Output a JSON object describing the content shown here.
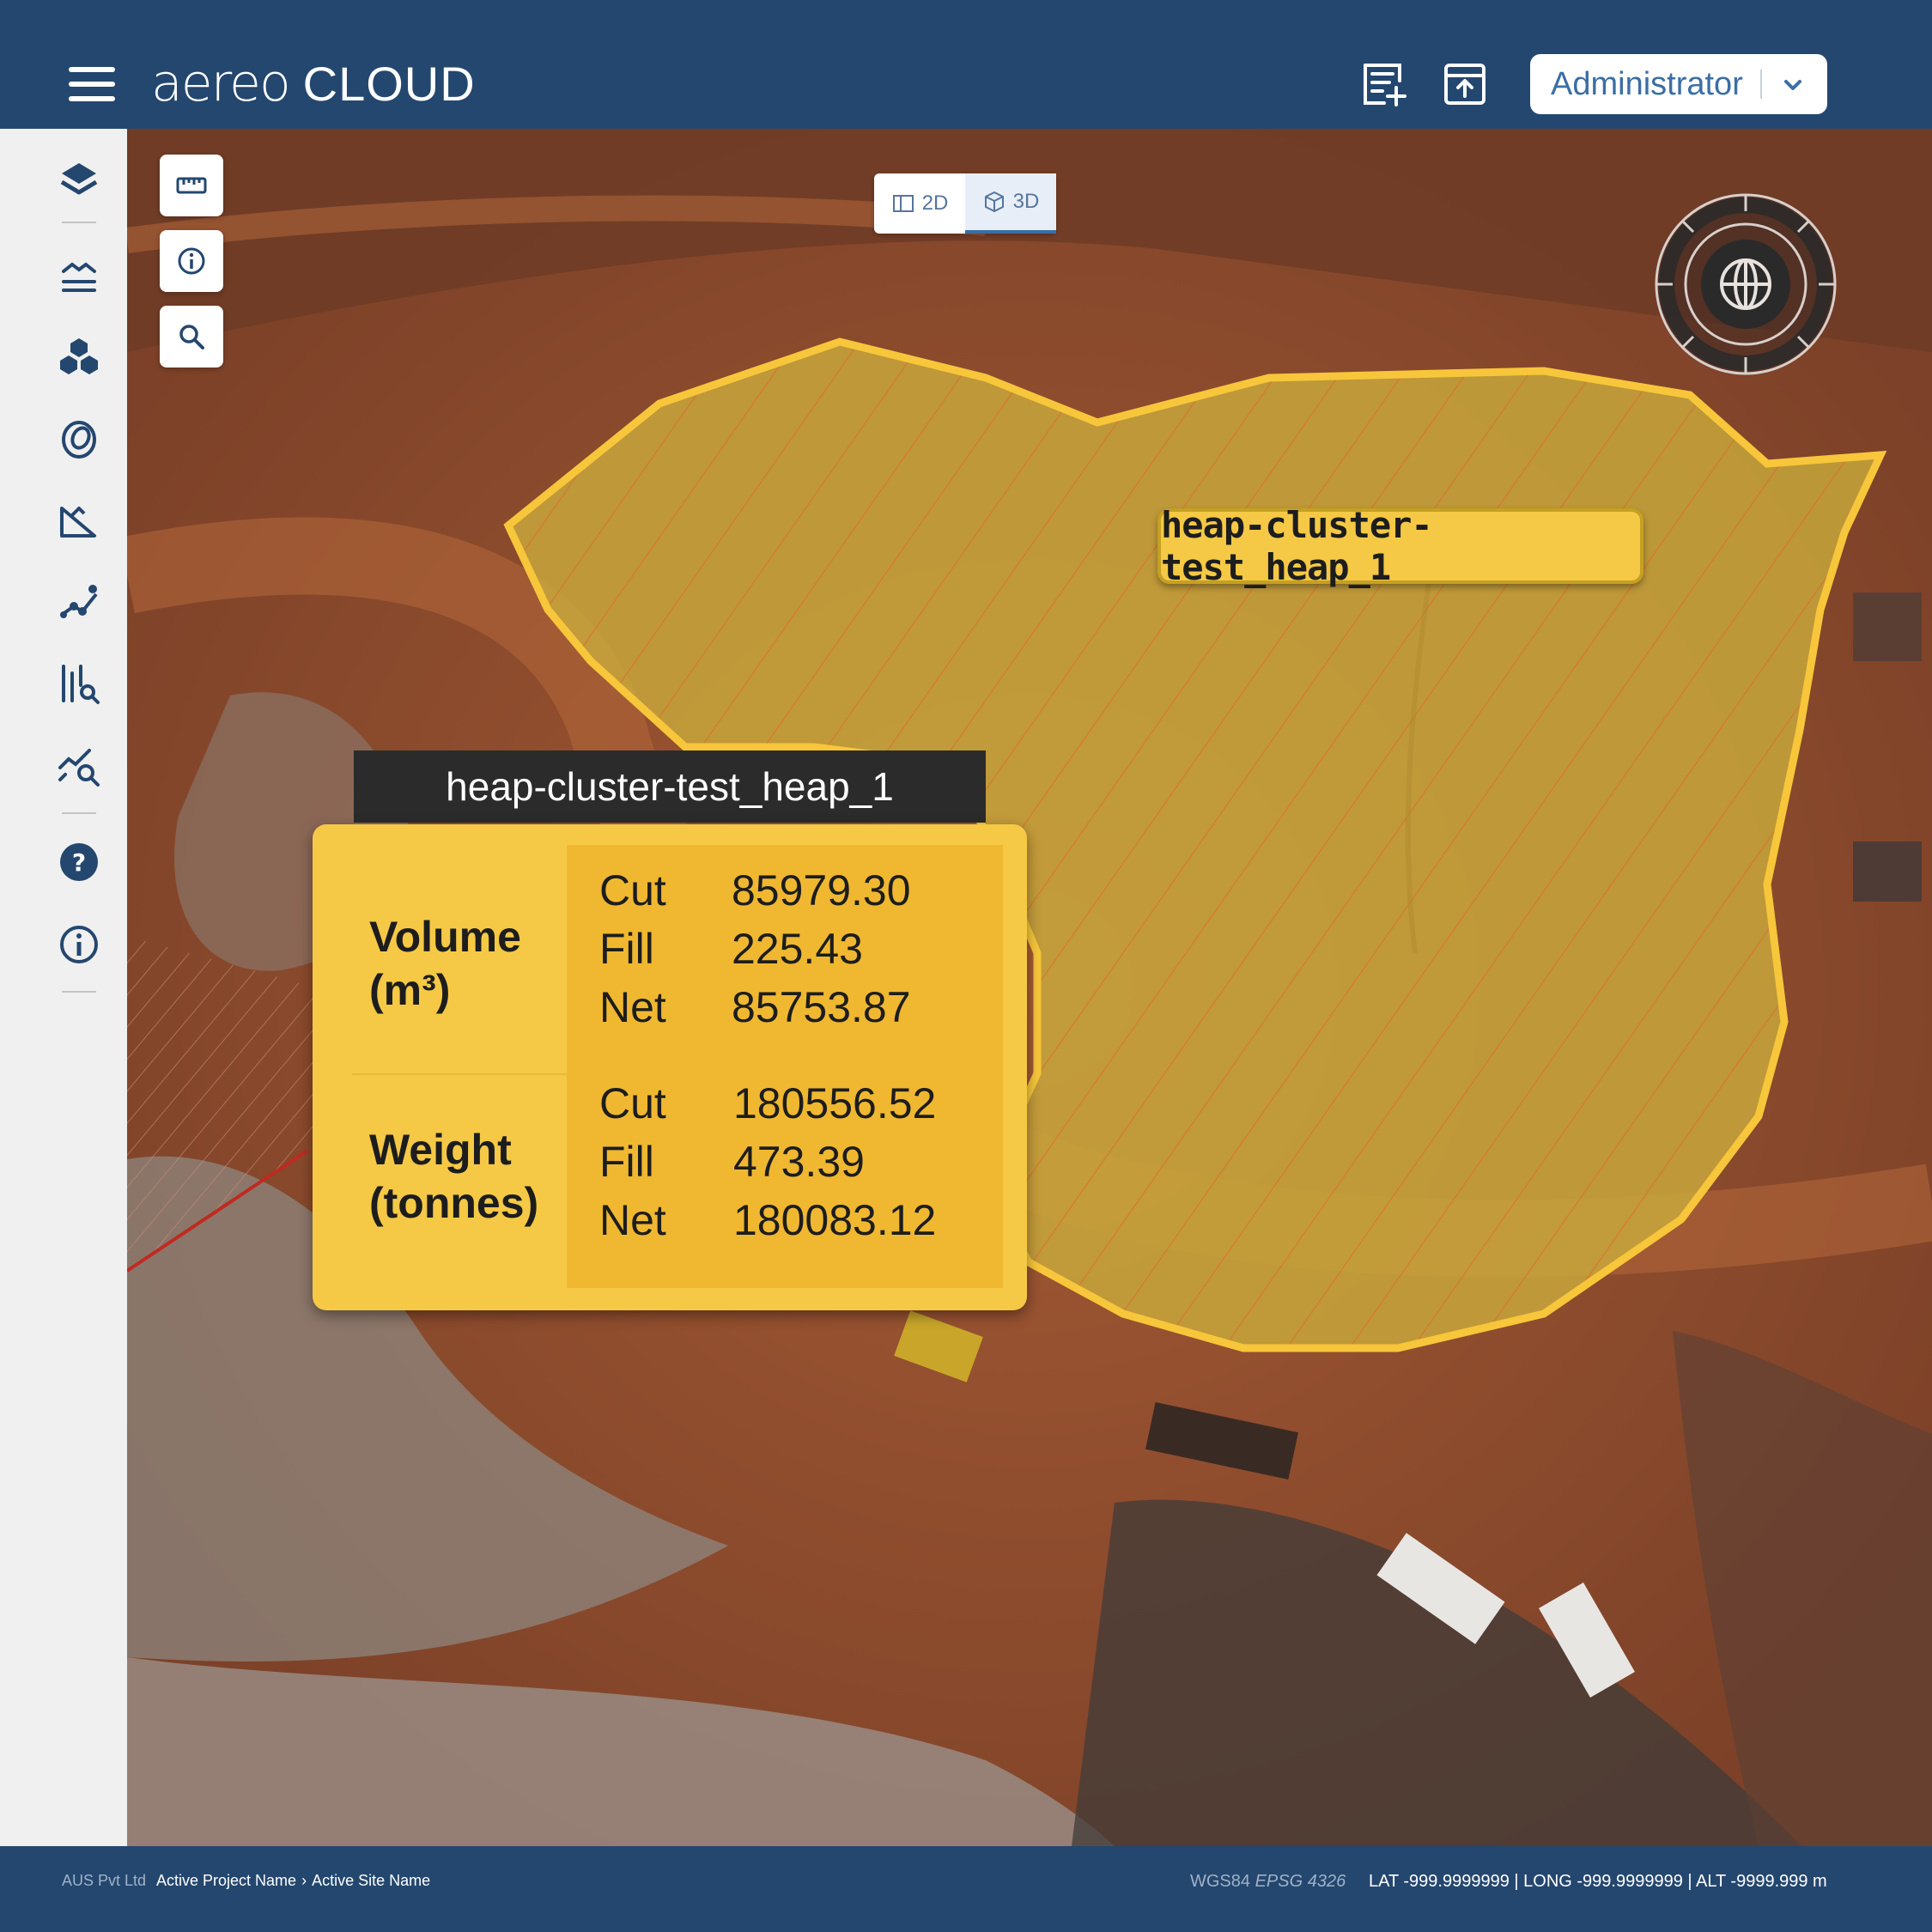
{
  "app": {
    "brand_mark": "aereo",
    "brand_suffix": "CLOUD"
  },
  "header": {
    "user_role": "Administrator"
  },
  "sidebar": {
    "items": [
      {
        "name": "layers"
      },
      {
        "name": "elevation"
      },
      {
        "name": "stockpiles"
      },
      {
        "name": "contours"
      },
      {
        "name": "slope"
      },
      {
        "name": "alignment"
      },
      {
        "name": "cross-section"
      },
      {
        "name": "analytics-search"
      },
      {
        "name": "help"
      },
      {
        "name": "info"
      }
    ]
  },
  "map": {
    "view_modes": [
      {
        "label": "2D",
        "active": false
      },
      {
        "label": "3D",
        "active": true
      }
    ],
    "heap_label": "heap-cluster-test_heap_1",
    "accent_color": "#f5c945"
  },
  "popup": {
    "title": "heap-cluster-test_heap_1",
    "volume": {
      "heading_line1": "Volume",
      "heading_line2": "(m³)",
      "cut_label": "Cut",
      "cut_value": "85979.30",
      "fill_label": "Fill",
      "fill_value": "225.43",
      "net_label": "Net",
      "net_value": "85753.87"
    },
    "weight": {
      "heading_line1": "Weight",
      "heading_line2": "(tonnes)",
      "cut_label": "Cut",
      "cut_value": "180556.52",
      "fill_label": "Fill",
      "fill_value": "473.39",
      "net_label": "Net",
      "net_value": "180083.12"
    }
  },
  "footer": {
    "company": "AUS Pvt Ltd",
    "project": "Active Project Name",
    "site": "Active Site Name",
    "crs_name": "WGS84",
    "crs_code": "EPSG 4326",
    "coords": "LAT -999.9999999 | LONG -999.9999999 | ALT -9999.999 m"
  }
}
